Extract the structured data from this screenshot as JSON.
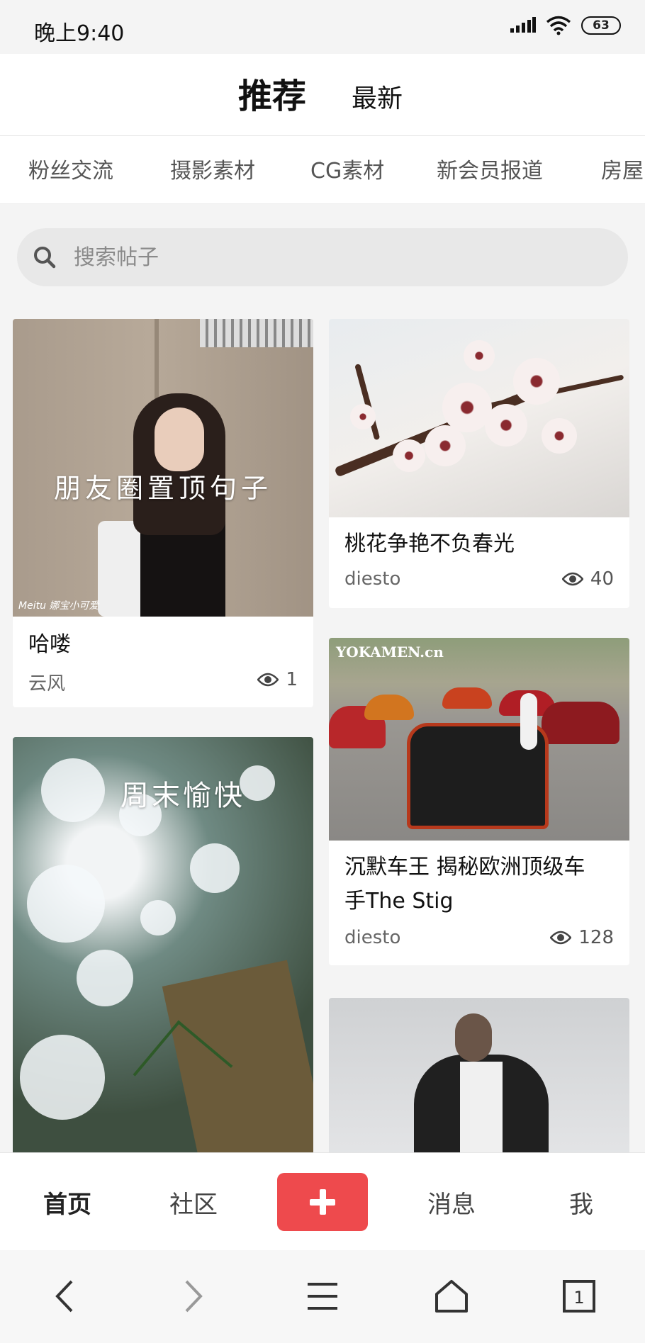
{
  "status_bar": {
    "time": "晚上9:40",
    "battery": "63"
  },
  "header_tabs": {
    "recommend": "推荐",
    "latest": "最新"
  },
  "categories": [
    "粉丝交流",
    "摄影素材",
    "CG素材",
    "新会员报道",
    "房屋"
  ],
  "search": {
    "placeholder": "搜索帖子"
  },
  "posts": [
    {
      "image_caption": "朋友圈置顶句子",
      "image_watermark": "Meitu 娜宝小可爱",
      "title": "哈喽",
      "author": "云风",
      "views": "1"
    },
    {
      "title": "桃花争艳不负春光",
      "author": "diesto",
      "views": "40"
    },
    {
      "image_caption": "周末愉快"
    },
    {
      "image_caption": "YOKAMEN.cn",
      "title_line1": "沉默车王 揭秘欧洲顶级车",
      "title_line2": "手The Stig",
      "author": "diesto",
      "views": "128"
    },
    {}
  ],
  "bottom_nav": {
    "home": "首页",
    "community": "社区",
    "messages": "消息",
    "me": "我"
  },
  "system_nav": {
    "tab_count": "1"
  },
  "colors": {
    "accent": "#ee4a4d",
    "background": "#f4f4f4"
  }
}
